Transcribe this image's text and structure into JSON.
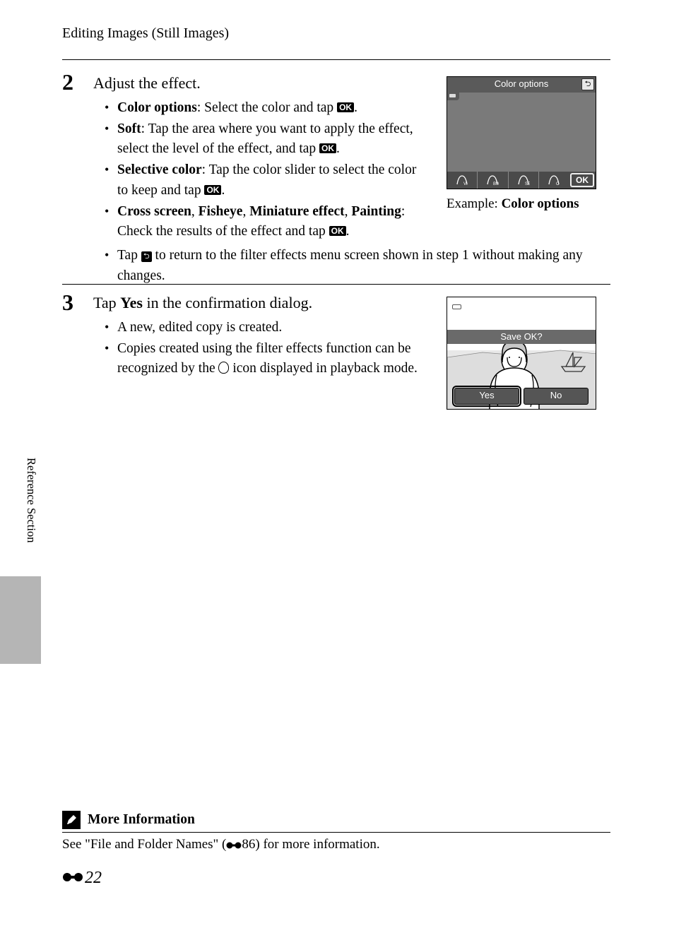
{
  "header": "Editing Images (Still Images)",
  "step2": {
    "num": "2",
    "title": "Adjust the effect.",
    "items": [
      {
        "bold": "Color options",
        "rest": ": Select the color and tap ",
        "tail": "."
      },
      {
        "bold": "Soft",
        "rest": ": Tap the area where you want to apply the effect, select the level of the effect, and tap ",
        "tail": "."
      },
      {
        "bold": "Selective color",
        "rest": ": Tap the color slider to select the color to keep and tap ",
        "tail": "."
      },
      {
        "bold_multi": [
          "Cross screen",
          "Fisheye",
          "Miniature effect",
          "Painting"
        ],
        "rest": ": Check the results of the effect and tap ",
        "tail": "."
      }
    ],
    "back_item": {
      "pre": "Tap ",
      "post": " to return to the filter effects menu screen shown in step 1 without making any changes."
    }
  },
  "fig1": {
    "title": "Color options",
    "ok": "OK",
    "caption_pre": "Example: ",
    "caption_bold": "Color options"
  },
  "step3": {
    "num": "3",
    "title_pre": "Tap ",
    "title_bold": "Yes",
    "title_post": " in the confirmation dialog.",
    "items": [
      "A new, edited copy is created.",
      "Copies created using the filter effects function can be recognized by the |ICON| icon displayed in playback mode."
    ]
  },
  "fig2": {
    "banner": "Save OK?",
    "yes": "Yes",
    "no": "No"
  },
  "side_tab": "Reference Section",
  "more_info": {
    "title": "More Information",
    "text_pre": "See \"File and Folder Names\" (",
    "text_ref": "86",
    "text_post": ") for more information."
  },
  "page_number": "22",
  "ok_label": "OK",
  "back_glyph": "⮌"
}
